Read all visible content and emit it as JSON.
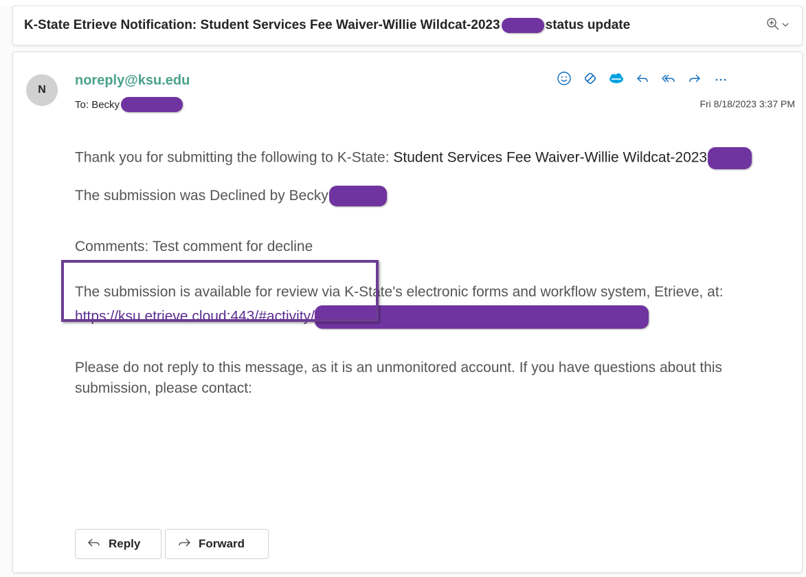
{
  "subject": {
    "prefix": "K-State Etrieve Notification: Student Services Fee Waiver-Willie Wildcat-2023",
    "suffix": "status update"
  },
  "message": {
    "avatar_initial": "N",
    "sender": "noreply@ksu.edu",
    "to_label": "To:",
    "to_name": "Becky",
    "date": "Fri 8/18/2023 3:37 PM"
  },
  "body": {
    "thanks_prefix": "Thank you for submitting the following to K-State: ",
    "thanks_form": "Student Services Fee Waiver-Willie Wildcat-2023",
    "declined_text": "The submission was Declined by Becky",
    "comments": "Comments: Test comment for decline",
    "available_text": "The submission is available for review via K-State's electronic forms and workflow system, Etrieve, at:",
    "link_prefix": "https://ksu.etrieve.cloud:443/#activity/",
    "noreply_text": "Please do not reply to this message, as it is an unmonitored account. If you have questions about this submission, please contact:"
  },
  "buttons": {
    "reply": "Reply",
    "forward": "Forward"
  },
  "colors": {
    "redaction": "#7034a0",
    "sender": "#4ba18b",
    "link": "#5c2d91",
    "highlight_box": "#6b3d93"
  },
  "icons": [
    "zoom-icon",
    "chevron-down-icon",
    "emoji-icon",
    "loop-icon",
    "salesforce-icon",
    "reply-icon",
    "reply-all-icon",
    "forward-icon",
    "more-icon"
  ]
}
